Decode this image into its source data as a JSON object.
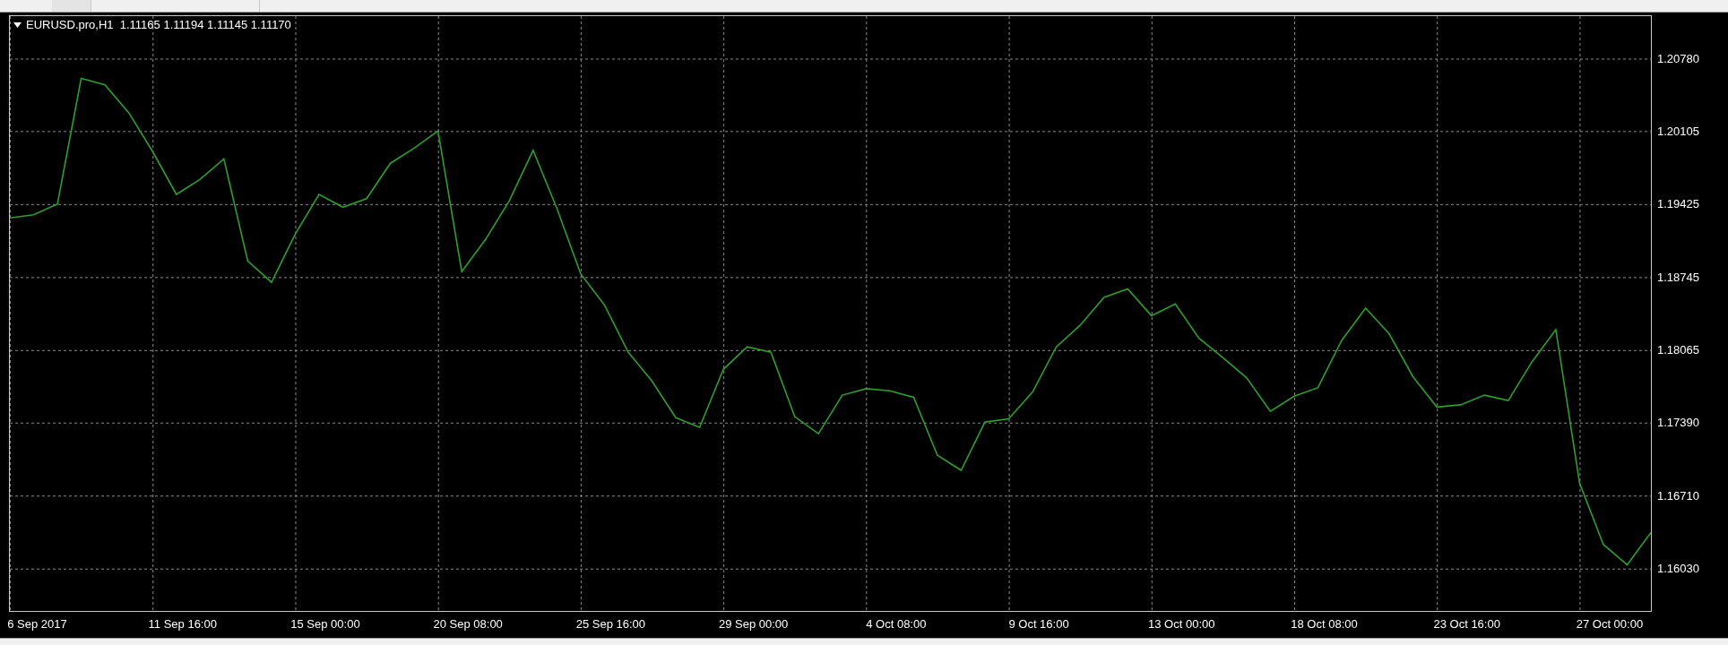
{
  "chart": {
    "title": "EURUSD.pro,H1  1.11165 1.11194 1.11145 1.11170",
    "chart_data": {
      "type": "line",
      "grid": true,
      "ylim": [
        1.1564,
        1.2118
      ],
      "categories": [
        null,
        "6 Sep 2017",
        null,
        null,
        null,
        null,
        null,
        "11 Sep 16:00",
        null,
        null,
        null,
        null,
        null,
        "15 Sep 00:00",
        null,
        null,
        null,
        null,
        null,
        "20 Sep 08:00",
        null,
        null,
        null,
        null,
        null,
        "25 Sep 16:00",
        null,
        null,
        null,
        null,
        null,
        "29 Sep 00:00",
        null,
        null,
        null,
        null,
        null,
        "4 Oct 08:00",
        null,
        null,
        null,
        null,
        null,
        "9 Oct 16:00",
        null,
        null,
        null,
        null,
        null,
        "13 Oct 00:00",
        null,
        null,
        null,
        null,
        null,
        "18 Oct 08:00",
        null,
        null,
        null,
        null,
        null,
        "23 Oct 16:00",
        null,
        null,
        null,
        null,
        null,
        "27 Oct 00:00",
        null,
        null
      ],
      "yticks": [
        {
          "value": 1.2078,
          "label": "1.20780"
        },
        {
          "value": 1.20105,
          "label": "1.20105"
        },
        {
          "value": 1.19425,
          "label": "1.19425"
        },
        {
          "value": 1.18745,
          "label": "1.18745"
        },
        {
          "value": 1.18065,
          "label": "1.18065"
        },
        {
          "value": 1.1739,
          "label": "1.17390"
        },
        {
          "value": 1.1671,
          "label": "1.16710"
        },
        {
          "value": 1.1603,
          "label": "1.16030"
        }
      ],
      "series": [
        {
          "color": "#2e9e2e",
          "values": [
            1.193,
            1.1933,
            1.1943,
            1.206,
            1.2054,
            1.2028,
            1.1992,
            1.1952,
            1.1966,
            1.1985,
            1.189,
            1.187,
            1.1915,
            1.1952,
            1.194,
            1.1948,
            1.1981,
            1.1995,
            1.2011,
            1.188,
            1.191,
            1.1946,
            1.1993,
            1.1939,
            1.1878,
            1.1849,
            1.1805,
            1.1778,
            1.1744,
            1.1735,
            1.1789,
            1.181,
            1.1805,
            1.1745,
            1.1729,
            1.1765,
            1.1771,
            1.1769,
            1.1763,
            1.1709,
            1.1695,
            1.174,
            1.1743,
            1.1768,
            1.181,
            1.183,
            1.1856,
            1.1864,
            1.1839,
            1.185,
            1.1818,
            1.18,
            1.1781,
            1.175,
            1.1764,
            1.1772,
            1.1816,
            1.1846,
            1.1822,
            1.1782,
            1.1754,
            1.1756,
            1.1765,
            1.176,
            1.1796,
            1.1826,
            1.1683,
            1.1626,
            1.1607,
            1.1637
          ]
        }
      ]
    }
  }
}
